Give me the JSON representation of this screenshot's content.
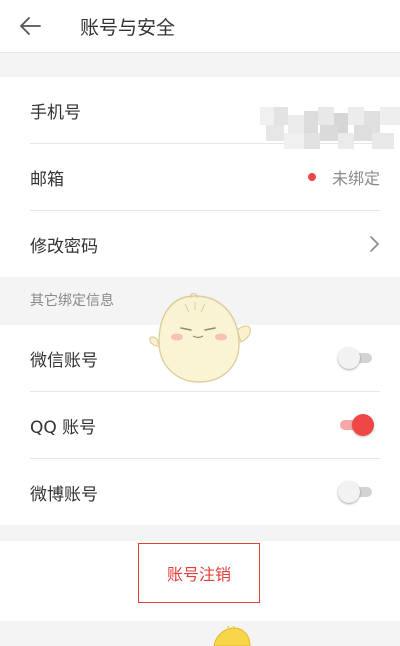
{
  "header": {
    "title": "账号与安全",
    "back_icon": "arrow-left-icon"
  },
  "account_rows": [
    {
      "label": "手机号"
    },
    {
      "label": "邮箱",
      "status": "未绑定",
      "status_color": "#f04646"
    },
    {
      "label": "修改密码",
      "icon": "chevron-right-icon"
    }
  ],
  "bound_section": {
    "title": "其它绑定信息"
  },
  "bindings": [
    {
      "label": "微信账号",
      "enabled": false
    },
    {
      "label": "QQ 账号",
      "enabled": true
    },
    {
      "label": "微博账号",
      "enabled": false
    }
  ],
  "logout_label": "账号注销",
  "colors": {
    "accent": "#f04646",
    "background": "#f4f4f4"
  }
}
